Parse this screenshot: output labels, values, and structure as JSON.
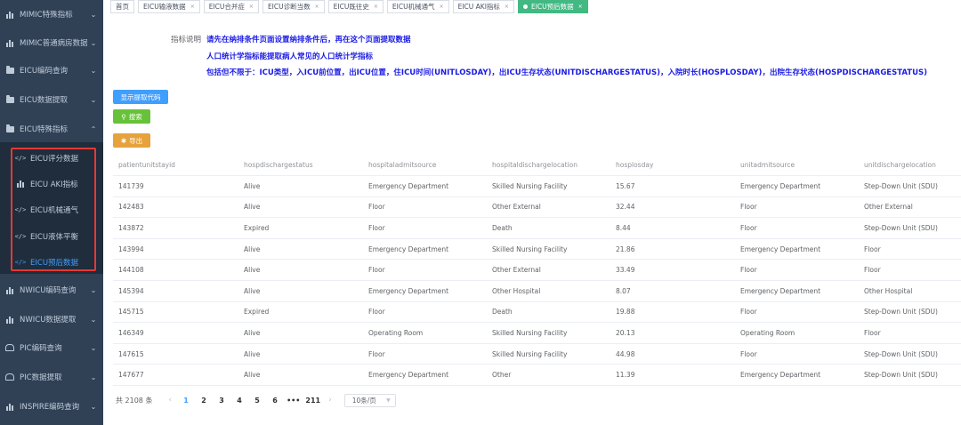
{
  "sidebar": {
    "items": [
      {
        "label": "MIMIC特殊指标",
        "icon": "bar-chart-icon",
        "chevron": "⌄"
      },
      {
        "label": "MIMIC普通病房数据",
        "icon": "bar-chart-icon",
        "chevron": "⌄"
      },
      {
        "label": "EICU编码查询",
        "icon": "folder-icon",
        "chevron": "⌄"
      },
      {
        "label": "EICU数据提取",
        "icon": "folder-icon",
        "chevron": "⌄"
      },
      {
        "label": "EICU特殊指标",
        "icon": "folder-icon",
        "chevron": "⌃"
      }
    ],
    "submenu": [
      {
        "label": "EICU评分数据",
        "icon": "code-icon"
      },
      {
        "label": "EICU AKI指标",
        "icon": "bar-chart-icon"
      },
      {
        "label": "EICU机械通气",
        "icon": "code-icon"
      },
      {
        "label": "EICU液体平衡",
        "icon": "code-icon"
      },
      {
        "label": "EICU预后数据",
        "icon": "code-icon",
        "active": true
      }
    ],
    "items_after": [
      {
        "label": "NWICU编码查询",
        "icon": "bar-chart-icon",
        "chevron": "⌄"
      },
      {
        "label": "NWICU数据提取",
        "icon": "bar-chart-icon",
        "chevron": "⌄"
      },
      {
        "label": "PIC编码查询",
        "icon": "car-icon",
        "chevron": "⌄"
      },
      {
        "label": "PIC数据提取",
        "icon": "car-icon",
        "chevron": "⌄"
      },
      {
        "label": "INSPIRE编码查询",
        "icon": "bar-chart-icon",
        "chevron": "⌄"
      }
    ]
  },
  "tabs": [
    {
      "label": "首页",
      "close": ""
    },
    {
      "label": "EICU输液数据",
      "close": "×"
    },
    {
      "label": "EICU合并症",
      "close": "×"
    },
    {
      "label": "EICU诊断当数",
      "close": "×"
    },
    {
      "label": "EICU既往史",
      "close": "×"
    },
    {
      "label": "EICU机械通气",
      "close": "×"
    },
    {
      "label": "EICU AKI指标",
      "close": "×"
    },
    {
      "label": "EICU预后数据",
      "close": "×",
      "active": true
    }
  ],
  "description": {
    "label": "指标说明",
    "lines": [
      "请先在纳排条件页面设置纳排条件后，再在这个页面提取数据",
      "人口统计学指标能提取病人常见的人口统计学指标",
      "包括但不限于：ICU类型，入ICU前位置，出ICU位置，住ICU时间(UNITLOSDAY)，出ICU生存状态(UNITDISCHARGESTATUS)，入院时长(HOSPLOSDAY)，出院生存状态(HOSPDISCHARGESTATUS)"
    ]
  },
  "buttons": {
    "show_code": "显示提取代码",
    "search": "搜索",
    "export": "导出"
  },
  "table": {
    "columns": [
      "patientunitstayid",
      "hospdischargestatus",
      "hospitaladmitsource",
      "hospitaldischargelocation",
      "hosplosday",
      "unitadmitsource",
      "unitdischargelocation"
    ],
    "rows": [
      [
        "141739",
        "Alive",
        "Emergency Department",
        "Skilled Nursing Facility",
        "15.67",
        "Emergency Department",
        "Step-Down Unit (SDU)"
      ],
      [
        "142483",
        "Alive",
        "Floor",
        "Other External",
        "32.44",
        "Floor",
        "Other External"
      ],
      [
        "143872",
        "Expired",
        "Floor",
        "Death",
        "8.44",
        "Floor",
        "Step-Down Unit (SDU)"
      ],
      [
        "143994",
        "Alive",
        "Emergency Department",
        "Skilled Nursing Facility",
        "21.86",
        "Emergency Department",
        "Floor"
      ],
      [
        "144108",
        "Alive",
        "Floor",
        "Other External",
        "33.49",
        "Floor",
        "Floor"
      ],
      [
        "145394",
        "Alive",
        "Emergency Department",
        "Other Hospital",
        "8.07",
        "Emergency Department",
        "Other Hospital"
      ],
      [
        "145715",
        "Expired",
        "Floor",
        "Death",
        "19.88",
        "Floor",
        "Step-Down Unit (SDU)"
      ],
      [
        "146349",
        "Alive",
        "Operating Room",
        "Skilled Nursing Facility",
        "20.13",
        "Operating Room",
        "Floor"
      ],
      [
        "147615",
        "Alive",
        "Floor",
        "Skilled Nursing Facility",
        "44.98",
        "Floor",
        "Step-Down Unit (SDU)"
      ],
      [
        "147677",
        "Alive",
        "Emergency Department",
        "Other",
        "11.39",
        "Emergency Department",
        "Step-Down Unit (SDU)"
      ]
    ]
  },
  "pagination": {
    "total": "共 2108 条",
    "prev": "‹",
    "next": "›",
    "pages": [
      "1",
      "2",
      "3",
      "4",
      "5",
      "6",
      "•••",
      "211"
    ],
    "current": "1",
    "page_size": "10条/页"
  },
  "colors": {
    "sidebar_bg": "#304156",
    "submenu_bg": "#1f2d3d",
    "active_tab": "#42b983",
    "accent": "#409eff",
    "highlight_box": "#e53935"
  }
}
